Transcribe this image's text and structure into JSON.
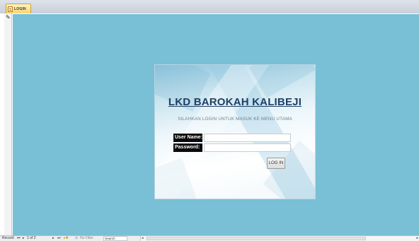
{
  "tab": {
    "label": "LOGIN",
    "icon": "form-icon"
  },
  "selector": {
    "icon": "pencil-icon"
  },
  "colors": {
    "detail_background": "#79bfd5",
    "title": "#1e3f66",
    "label_background": "#0a0a0a",
    "tab_accent": "#f8d46a"
  },
  "form": {
    "title": "LKD BAROKAH KALIBEJI",
    "subtitle": "SILAHKAN LOGIN UNTUK MASUK KE MENU UTAMA",
    "username_label": "User Name:",
    "username_value": "",
    "password_label": "Password:",
    "password_value": "",
    "login_button": "LOG IN"
  },
  "navbar": {
    "record_label": "Record:",
    "first_icon": "first-record-icon",
    "prev_icon": "previous-record-icon",
    "position": "1 of 2",
    "next_icon": "next-record-icon",
    "last_icon": "last-record-icon",
    "new_icon": "new-record-icon",
    "filter_label": "No Filter",
    "search_label": "Search"
  }
}
